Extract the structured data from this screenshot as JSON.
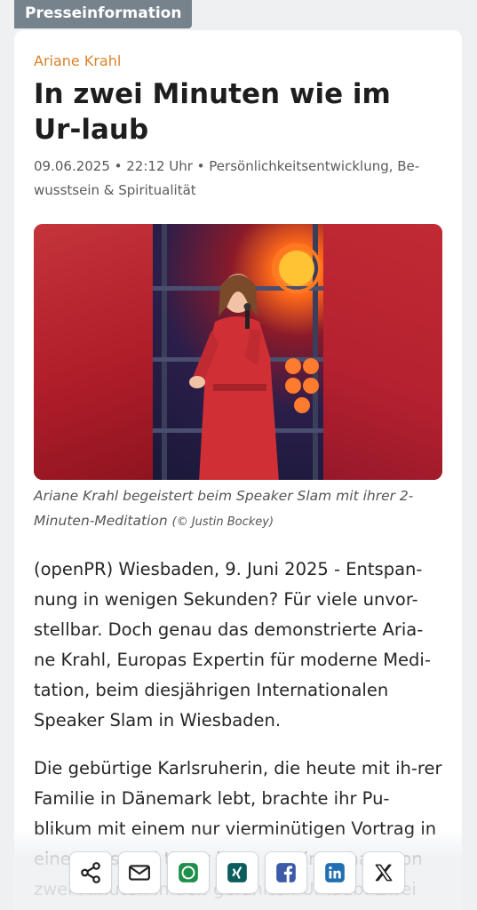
{
  "label": "Presseinformation",
  "article": {
    "author": "Ariane Krahl",
    "title": "In zwei Minuten wie im Ur-laub",
    "meta": "09.06.2025 • 22:12 Uhr • Persönlichkeitsentwicklung, Be-wusstsein & Spiritualität",
    "image_caption": "Ariane Krahl begeistert beim Speaker Slam mit ihrer 2-Minuten-Meditation",
    "image_credit": "(© Justin Bockey)",
    "paragraphs": [
      "(openPR) Wiesbaden, 9. Juni 2025 - Entspan-nung in wenigen Sekunden? Für viele unvor-stellbar. Doch genau das demonstrierte Aria-ne Krahl, Europas Expertin für moderne Medi-tation, beim diesjährigen Internationalen Speaker Slam in Wiesbaden.",
      "Die gebürtige Karlsruherin, die heute mit ih-rer Familie in Dänemark lebt, brachte ihr Pu-blikum mit einem nur vierminütigen Vortrag in einen Zustand tiefer Ruhe und innerhalb von zwei Minuten in den gefühlten Ur-laub. Zwei Minuten davon widmete sie einer"
    ]
  },
  "share": [
    {
      "icon": "share-icon",
      "color": "#1f1f1f"
    },
    {
      "icon": "mail-icon",
      "color": "#1f1f1f"
    },
    {
      "icon": "whatsapp-icon",
      "color": "#1d8f4a"
    },
    {
      "icon": "xing-icon",
      "color": "#0b5c5c"
    },
    {
      "icon": "facebook-icon",
      "color": "#3b5ba8"
    },
    {
      "icon": "linkedin-icon",
      "color": "#1f6fb2"
    },
    {
      "icon": "x-icon",
      "color": "#1f1f1f"
    }
  ]
}
